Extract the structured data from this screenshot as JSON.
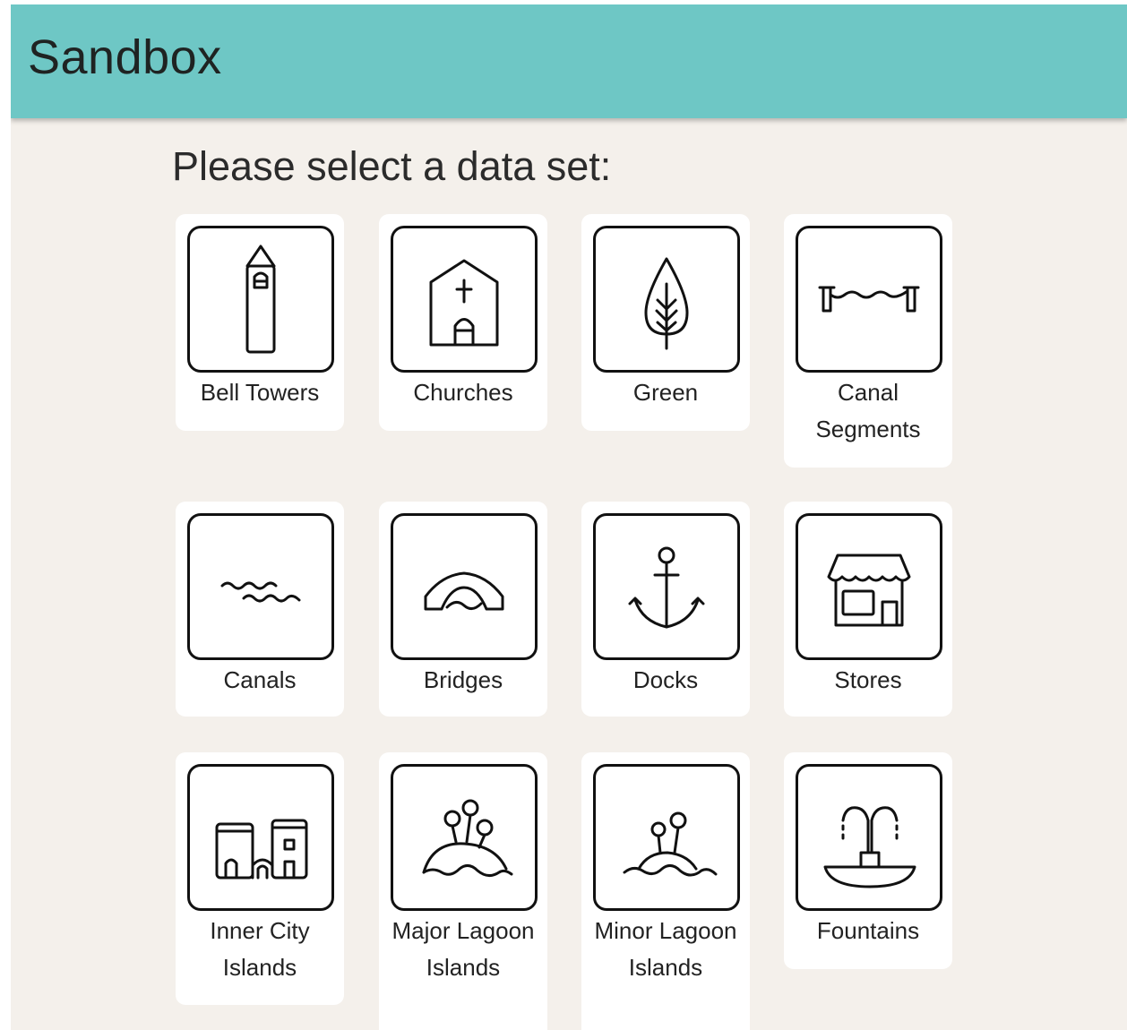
{
  "app": {
    "title": "Sandbox"
  },
  "prompt": "Please select a data set:",
  "datasets": [
    {
      "label": "Bell Towers",
      "icon": "bell-tower-icon"
    },
    {
      "label": "Churches",
      "icon": "church-icon"
    },
    {
      "label": "Green",
      "icon": "tree-leaf-icon"
    },
    {
      "label": "Canal Segments",
      "icon": "canal-segment-icon"
    },
    {
      "label": "Canals",
      "icon": "waves-icon"
    },
    {
      "label": "Bridges",
      "icon": "bridge-icon"
    },
    {
      "label": "Docks",
      "icon": "anchor-icon"
    },
    {
      "label": "Stores",
      "icon": "store-icon"
    },
    {
      "label": "Inner City Islands",
      "icon": "city-island-icon"
    },
    {
      "label": "Major Lagoon Islands",
      "icon": "major-island-icon"
    },
    {
      "label": "Minor Lagoon Islands",
      "icon": "minor-island-icon"
    },
    {
      "label": "Fountains",
      "icon": "fountain-icon"
    }
  ],
  "colors": {
    "header": "#6ec7c5",
    "background": "#f4f0eb",
    "card": "#ffffff"
  }
}
